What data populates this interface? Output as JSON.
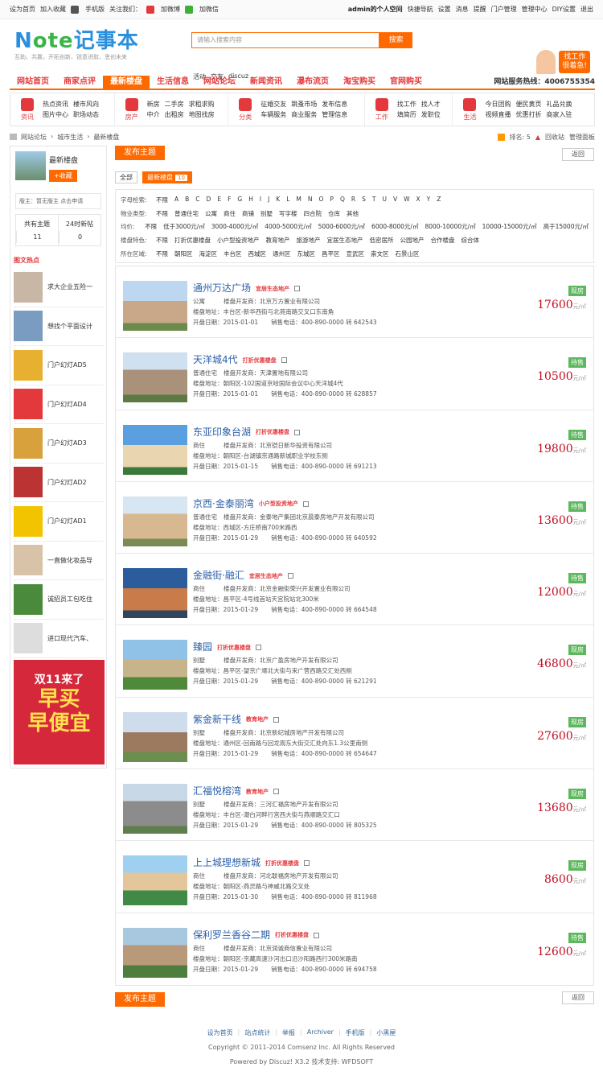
{
  "topbar": {
    "left": [
      "设为首页",
      "加入收藏",
      "手机版",
      "关注我们：",
      "加微博",
      "加微信"
    ],
    "user": "admin的个人空间",
    "right": [
      "快捷导航",
      "设置",
      "消息",
      "提醒",
      "门户管理",
      "管理中心",
      "DIY设置",
      "退出"
    ]
  },
  "logo": {
    "text_a": "N",
    "text_b": "ote",
    "text_c": "记事本",
    "slogan": "互助、共赢，开拓创新、锐意进取、思创未来"
  },
  "search": {
    "placeholder": "请输入搜索内容",
    "button": "搜索",
    "hot": [
      "活动",
      "交友",
      "discuz"
    ]
  },
  "ad_header": {
    "line1": "找工作",
    "line2": "很着急!"
  },
  "nav": {
    "items": [
      "网站首页",
      "商家点评",
      "最新楼盘",
      "生活信息",
      "网站论坛",
      "新闻资讯",
      "瀑布流页",
      "淘宝购买",
      "官网购买"
    ],
    "active": 2,
    "hotline": "网站服务热线：4006755354"
  },
  "subnav": [
    {
      "icon": "资讯",
      "links": [
        "热点资讯",
        "楼市风向",
        "图片中心",
        "职场动态"
      ]
    },
    {
      "icon": "房产",
      "links": [
        "新房",
        "二手房",
        "求租求购",
        "中介",
        "出租房",
        "地图找房"
      ]
    },
    {
      "icon": "分类",
      "links": [
        "征婚交友",
        "跳蚤市场",
        "发布信息",
        "车辆服务",
        "商业服务",
        "管理信息"
      ]
    },
    {
      "icon": "工作",
      "links": [
        "找工作",
        "找人才",
        "填简历",
        "发职位"
      ]
    },
    {
      "icon": "生活",
      "links": [
        "今日团购",
        "便民黄页",
        "礼品兑换",
        "视频直播",
        "优惠打折",
        "商家入驻"
      ]
    }
  ],
  "crumb": {
    "items": [
      "网站论坛",
      "城市生活",
      "最新楼盘"
    ],
    "rank_label": "排名: 5",
    "recycle": "回收站",
    "manage": "管理面板"
  },
  "side": {
    "forum_name": "最新楼盘",
    "fav": "+收藏",
    "moderator": "版主：暂无版主 点击申请",
    "stats": [
      {
        "label": "共有主题",
        "value": "11"
      },
      {
        "label": "24时新帖",
        "value": "0"
      }
    ],
    "pic_title": "图文热点",
    "pics": [
      "求大企业五险一",
      "想找个平面设计",
      "门户幻灯AD5",
      "门户幻灯AD4",
      "门户幻灯AD3",
      "门户幻灯AD2",
      "门户幻灯AD1",
      "一直做化妆品导",
      "诚招员工包吃住",
      "进口现代汽车、"
    ],
    "ad": {
      "a1": "双11来了",
      "a2": "早买",
      "a3": "早便宜"
    }
  },
  "post_button": "发布主题",
  "back_button": "返回",
  "tabs": {
    "all": "全部",
    "current": "最新楼盘",
    "count": "10"
  },
  "filters": [
    {
      "label": "字母检索:",
      "options": [
        "不限",
        "A",
        "B",
        "C",
        "D",
        "E",
        "F",
        "G",
        "H",
        "I",
        "J",
        "K",
        "L",
        "M",
        "N",
        "O",
        "P",
        "Q",
        "R",
        "S",
        "T",
        "U",
        "V",
        "W",
        "X",
        "Y",
        "Z"
      ]
    },
    {
      "label": "物业类型:",
      "options": [
        "不限",
        "普通住宅",
        "公寓",
        "商住",
        "商铺",
        "别墅",
        "写字楼",
        "四合院",
        "仓库",
        "其他"
      ]
    },
    {
      "label": "均价:",
      "options": [
        "不限",
        "低于3000元/㎡",
        "3000-4000元/㎡",
        "4000-5000元/㎡",
        "5000-6000元/㎡",
        "6000-8000元/㎡",
        "8000-10000元/㎡",
        "10000-15000元/㎡",
        "高于15000元/㎡"
      ]
    },
    {
      "label": "楼盘特色:",
      "options": [
        "不限",
        "打折优惠楼盘",
        "小户型投资地产",
        "教育地产",
        "旅游地产",
        "宜居生态地产",
        "低密居所",
        "公园地产",
        "合作楼盘",
        "综合体"
      ]
    },
    {
      "label": "所在区域:",
      "options": [
        "不限",
        "朝阳区",
        "海淀区",
        "丰台区",
        "西城区",
        "通州区",
        "东城区",
        "昌平区",
        "宣武区",
        "崇文区",
        "石景山区"
      ]
    }
  ],
  "labels": {
    "developer": "楼盘开发商：",
    "address": "楼盘地址：",
    "open": "开盘日期：",
    "phone": "销售电话：",
    "unit": "元/㎡"
  },
  "listings": [
    {
      "name": "通州万达广场",
      "tag": "宜居生态地产",
      "type": "公寓",
      "developer": "北京万方置业有限公司",
      "address": "丰台区-新华西街与北苑南路交叉口东南角",
      "date": "2015-01-01",
      "phone": "400-890-0000 转 642543",
      "status": "现房",
      "price": "17600"
    },
    {
      "name": "天洋城4代",
      "tag": "打折优惠楼盘",
      "type": "普通住宅",
      "developer": "天津置地有限公司",
      "address": "朝阳区-102国道京哈国际会议中心天洋城4代",
      "date": "2015-01-01",
      "phone": "400-890-0000 转 628857",
      "status": "待售",
      "price": "10500"
    },
    {
      "name": "东亚印象台湖",
      "tag": "打折优惠楼盘",
      "type": "商住",
      "developer": "北京铠日新华投资有限公司",
      "address": "朝阳区-台湖镇京通路新城职业学校东侧",
      "date": "2015-01-15",
      "phone": "400-890-0000 转 691213",
      "status": "待售",
      "price": "19800"
    },
    {
      "name": "京西·金泰丽湾",
      "tag": "小户型投资地产",
      "type": "普通住宅",
      "developer": "金泰地产集团北京晨泰房地产开发有限公司",
      "address": "西城区-方庄桥南700米路西",
      "date": "2015-01-29",
      "phone": "400-890-0000 转 640592",
      "status": "待售",
      "price": "13600"
    },
    {
      "name": "金融街·融汇",
      "tag": "宜居生态地产",
      "type": "商住",
      "developer": "北京金融街荣兴开发置业有限公司",
      "address": "昌平区-4号线首站天宫院站北300米",
      "date": "2015-01-29",
      "phone": "400-890-0000 转 664548",
      "status": "待售",
      "price": "12000"
    },
    {
      "name": "臻园",
      "tag": "打折优惠楼盘",
      "type": "别墅",
      "developer": "北京广盈房地产开发有限公司",
      "address": "昌平区-望京广顺北大街与来广营西路交汇处西侧",
      "date": "2015-01-29",
      "phone": "400-890-0000 转 621291",
      "status": "现房",
      "price": "46800"
    },
    {
      "name": "紫金新干线",
      "tag": "教育地产",
      "type": "别墅",
      "developer": "北京新纪城房地产开发有限公司",
      "address": "通州区-回南路与回龙观东大街交汇处向东1.3公里南侧",
      "date": "2015-01-29",
      "phone": "400-890-0000 转 654647",
      "status": "现房",
      "price": "27600"
    },
    {
      "name": "汇福悦榕湾",
      "tag": "教育地产",
      "type": "别墅",
      "developer": "三河汇福房地产开发有限公司",
      "address": "丰台区-潮白河畔行宫西大街与燕顺路交汇口",
      "date": "2015-01-29",
      "phone": "400-890-0000 转 805325",
      "status": "现房",
      "price": "13680"
    },
    {
      "name": "上上城理想新城",
      "tag": "打折优惠楼盘",
      "type": "商住",
      "developer": "河北联福房地产开发有限公司",
      "address": "朝阳区-燕灵路与神威北路交叉处",
      "date": "2015-01-30",
      "phone": "400-890-0000 转 811968",
      "status": "现房",
      "price": "8600"
    },
    {
      "name": "保利罗兰香谷二期",
      "tag": "打折优惠楼盘",
      "type": "商住",
      "developer": "北京润诚商信置业有限公司",
      "address": "朝阳区-京藏高速沙河出口沿沙阳路西行300米路南",
      "date": "2015-01-29",
      "phone": "400-890-0000 转 694758",
      "status": "待售",
      "price": "12600"
    }
  ],
  "footer": {
    "links": [
      "设为首页",
      "站点统计",
      "举报",
      "Archiver",
      "手机版",
      "小黑屋"
    ],
    "copyright": "Copyright © 2011-2014 Comsenz Inc. All Rights Reserved",
    "powered": "Powered by Discuz! X3.2 技术支持: WFDSOFT"
  },
  "colors": {
    "accent": "#ff6a00",
    "link": "#2a5fa8",
    "price": "#c30d23",
    "status": "#5cb85c"
  }
}
